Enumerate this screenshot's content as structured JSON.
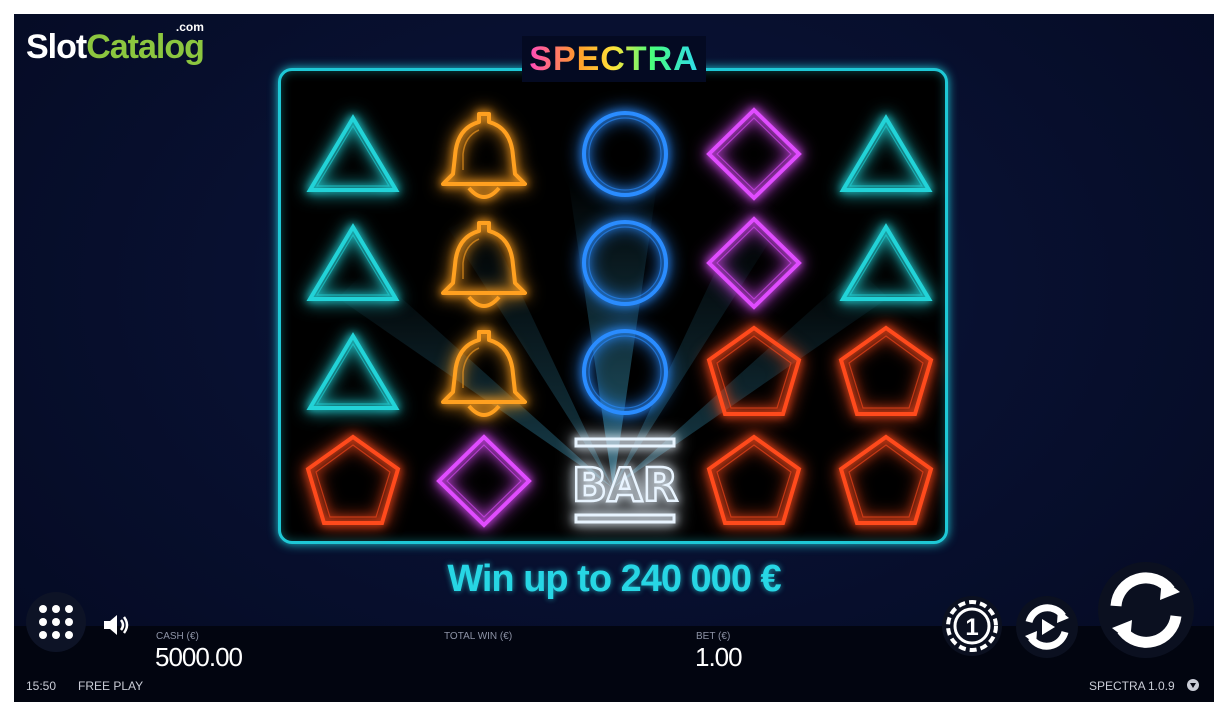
{
  "brand": {
    "word1": "Slot",
    "word2": "Catalog",
    "suffix": ".com"
  },
  "game": {
    "title": "SPECTRA",
    "promo": "Win up to 240 000 €"
  },
  "reels": [
    [
      "triangle",
      "bell",
      "circle",
      "diamond",
      "triangle"
    ],
    [
      "triangle",
      "bell",
      "circle",
      "diamond",
      "triangle"
    ],
    [
      "triangle",
      "bell",
      "circle",
      "pentagon",
      "pentagon"
    ],
    [
      "pentagon",
      "diamond",
      "bar",
      "pentagon",
      "pentagon"
    ]
  ],
  "symbol_colors": {
    "triangle": "#22d3d8",
    "bell": "#ffa020",
    "circle": "#2a8cff",
    "diamond": "#e04cff",
    "pentagon": "#ff4a1c",
    "bar": "#e8f4ff"
  },
  "bar_symbol_text": "BAR",
  "hud": {
    "cash_label": "CASH (€)",
    "cash_value": "5000.00",
    "total_win_label": "TOTAL WIN (€)",
    "total_win_value": "",
    "bet_label": "BET (€)",
    "bet_value": "1.00",
    "time": "15:50",
    "mode": "FREE PLAY",
    "game_name": "SPECTRA",
    "version": "1.0.9"
  },
  "icons": {
    "menu": "menu-dots-icon",
    "sound": "speaker-icon",
    "coin": "coin-value-icon",
    "autoplay": "autoplay-icon",
    "spin": "spin-icon",
    "help": "help-icon"
  },
  "coin_button_value": "1"
}
